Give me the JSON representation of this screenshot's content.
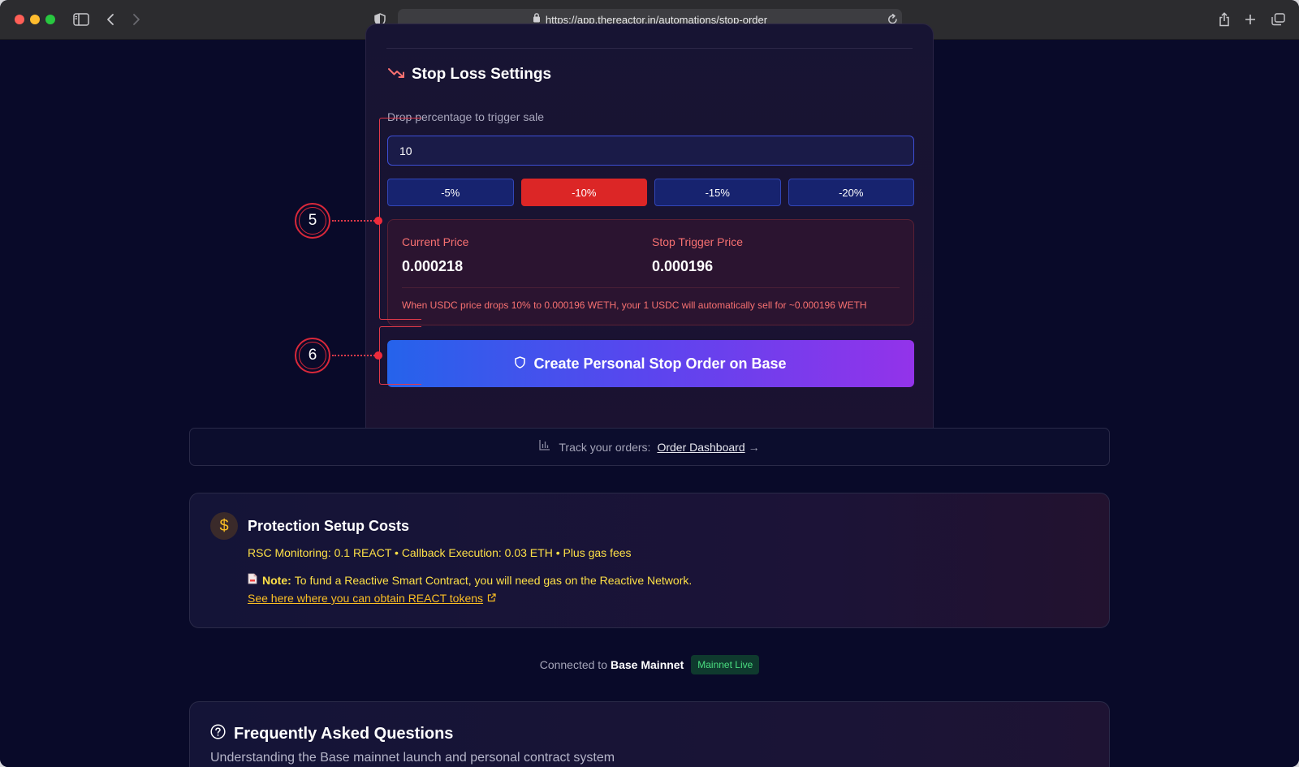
{
  "browser": {
    "url": "https://app.thereactor.in/automations/stop-order"
  },
  "stop_loss": {
    "title": "Stop Loss Settings",
    "drop_label": "Drop percentage to trigger sale",
    "drop_value": "10",
    "presets": [
      "-5%",
      "-10%",
      "-15%",
      "-20%"
    ],
    "active_preset": "-10%",
    "current_price_label": "Current Price",
    "current_price": "0.000218",
    "trigger_price_label": "Stop Trigger Price",
    "trigger_price": "0.000196",
    "note": "When USDC price drops 10% to 0.000196 WETH, your 1 USDC will automatically sell for ~0.000196 WETH",
    "create_button": "Create Personal Stop Order on Base"
  },
  "callouts": [
    "5",
    "6"
  ],
  "track": {
    "text": "Track your orders:",
    "link": "Order Dashboard",
    "arrow": "→"
  },
  "costs": {
    "icon_glyph": "$",
    "title": "Protection Setup Costs",
    "line": "RSC Monitoring: 0.1 REACT • Callback Execution: 0.03 ETH • Plus gas fees",
    "note_label": "Note:",
    "note_text": "To fund a Reactive Smart Contract, you will need gas on the Reactive Network.",
    "link": "See here where you can obtain REACT tokens"
  },
  "connection": {
    "prefix": "Connected to",
    "network": "Base Mainnet",
    "badge": "Mainnet Live"
  },
  "faq": {
    "title": "Frequently Asked Questions",
    "subtitle": "Understanding the Base mainnet launch and personal contract system"
  },
  "colors": {
    "page_bg": "#090a29",
    "accent_red": "#dc2626",
    "preset_blue": "#17236f",
    "gradient_start": "#2563eb",
    "gradient_end": "#9333ea",
    "warning_yellow": "#fde047",
    "live_green": "#4ade80"
  },
  "icons": [
    "sidebar-icon",
    "back-icon",
    "forward-icon",
    "shield-icon",
    "lock-icon",
    "reload-icon",
    "share-icon",
    "new-tab-icon",
    "tabs-icon",
    "trending-down-icon",
    "shield-outline-icon",
    "bar-chart-icon",
    "arrow-right-icon",
    "dollar-icon",
    "document-icon",
    "external-link-icon",
    "help-circle-icon"
  ]
}
